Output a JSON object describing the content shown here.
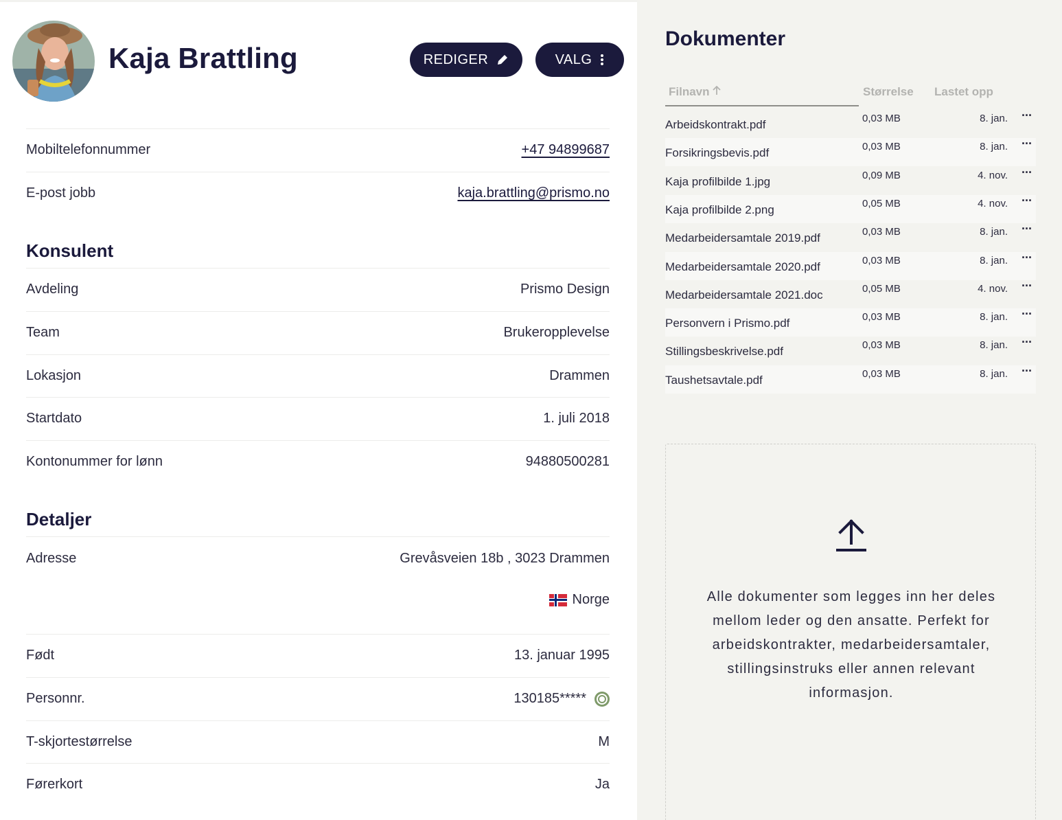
{
  "profile": {
    "name": "Kaja Brattling",
    "avatar_icon": "avatar-photo",
    "edit_label": "REDIGER",
    "options_label": "VALG"
  },
  "contact": [
    {
      "label": "Mobiltelefonnummer",
      "value": "+47 94899687"
    },
    {
      "label": "E-post jobb",
      "value": "kaja.brattling@prismo.no"
    }
  ],
  "konsulent": {
    "title": "Konsulent",
    "rows": [
      {
        "label": "Avdeling",
        "value": "Prismo Design"
      },
      {
        "label": "Team",
        "value": "Brukeropplevelse"
      },
      {
        "label": "Lokasjon",
        "value": "Drammen"
      },
      {
        "label": "Startdato",
        "value": "1. juli 2018"
      },
      {
        "label": "Kontonummer for lønn",
        "value": "94880500281"
      }
    ]
  },
  "detaljer": {
    "title": "Detaljer",
    "address": {
      "label": "Adresse",
      "value": "Grevåsveien 18b , 3023 Drammen",
      "country": "Norge"
    },
    "rows": [
      {
        "label": "Født",
        "value": "13. januar 1995"
      },
      {
        "label": "Personnr.",
        "value": "130185*****"
      },
      {
        "label": "T-skjortestørrelse",
        "value": "M"
      },
      {
        "label": "Førerkort",
        "value": "Ja"
      }
    ]
  },
  "documents": {
    "title": "Dokumenter",
    "headers": {
      "name": "Filnavn",
      "size": "Størrelse",
      "uploaded": "Lastet opp"
    },
    "files": [
      {
        "name": "Arbeidskontrakt.pdf",
        "size": "0,03 MB",
        "date": "8. jan."
      },
      {
        "name": "Forsikringsbevis.pdf",
        "size": "0,03 MB",
        "date": "8. jan."
      },
      {
        "name": "Kaja profilbilde 1.jpg",
        "size": "0,09 MB",
        "date": "4. nov."
      },
      {
        "name": "Kaja profilbilde 2.png",
        "size": "0,05 MB",
        "date": "4. nov."
      },
      {
        "name": "Medarbeidersamtale 2019.pdf",
        "size": "0,03 MB",
        "date": "8. jan."
      },
      {
        "name": "Medarbeidersamtale 2020.pdf",
        "size": "0,03 MB",
        "date": "8. jan."
      },
      {
        "name": "Medarbeidersamtale 2021.doc",
        "size": "0,05 MB",
        "date": "4. nov."
      },
      {
        "name": "Personvern i Prismo.pdf",
        "size": "0,03 MB",
        "date": "8. jan."
      },
      {
        "name": "Stillingsbeskrivelse.pdf",
        "size": "0,03 MB",
        "date": "8. jan."
      },
      {
        "name": "Taushetsavtale.pdf",
        "size": "0,03 MB",
        "date": "8. jan."
      }
    ],
    "more_label": "···",
    "upload_text": "Alle dokumenter som legges inn her deles mellom leder og den ansatte. Perfekt for arbeidskontrakter, medarbeidersamtaler, stillingsinstruks eller annen relevant informasjon."
  }
}
